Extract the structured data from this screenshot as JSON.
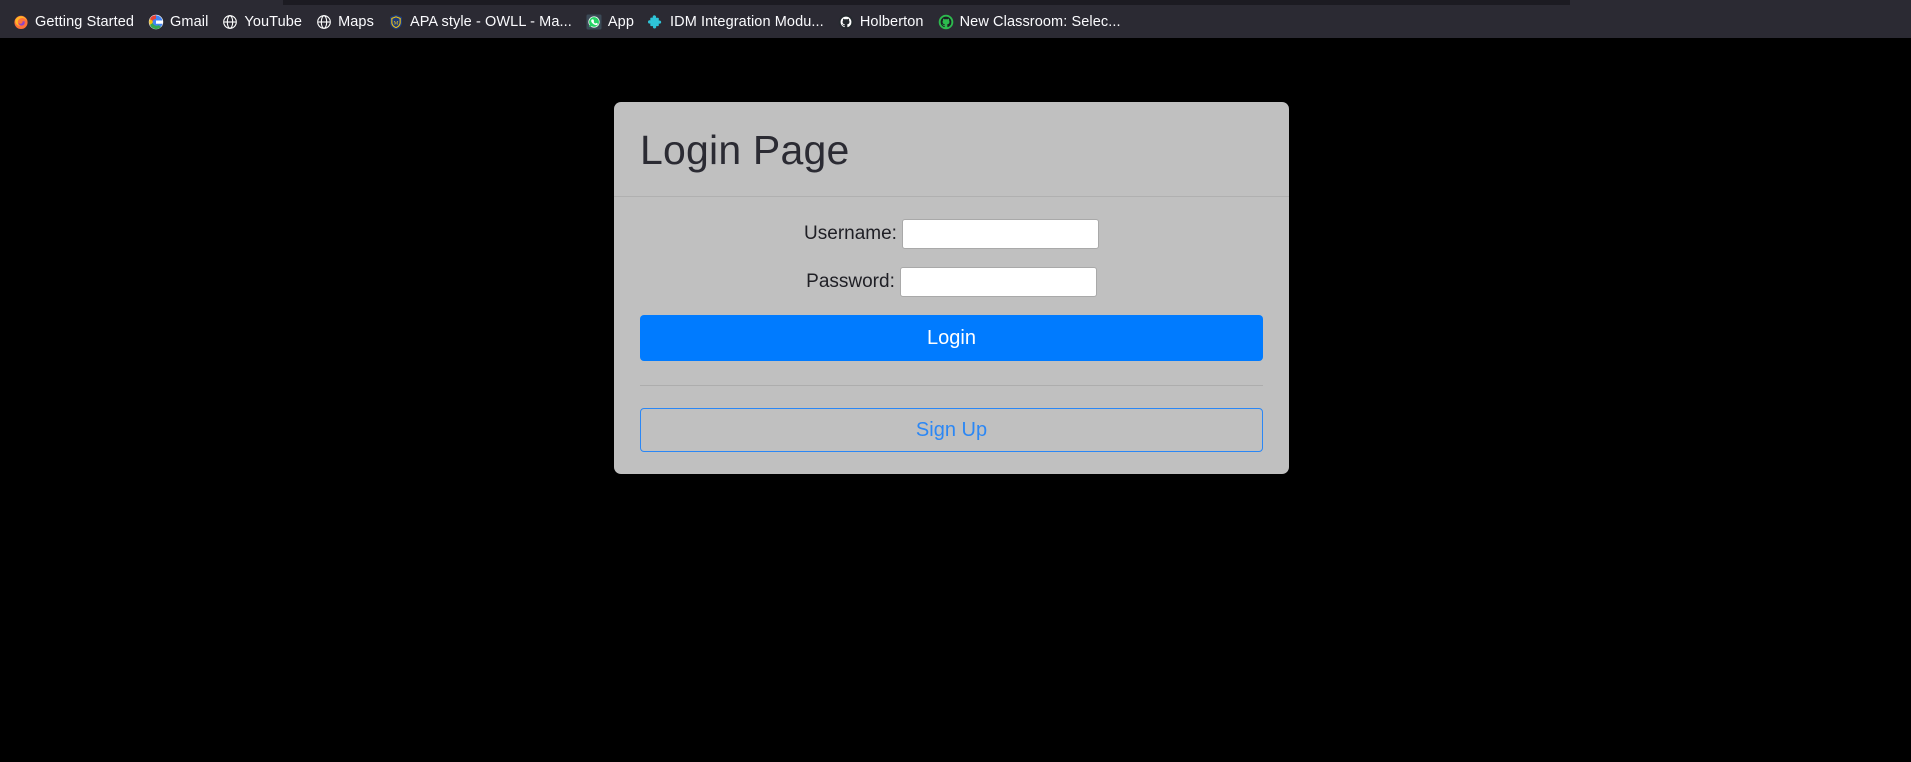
{
  "browser": {
    "bookmarks": [
      {
        "label": "Getting Started",
        "icon": "firefox-icon"
      },
      {
        "label": "Gmail",
        "icon": "gmail-icon"
      },
      {
        "label": "YouTube",
        "icon": "globe-icon"
      },
      {
        "label": "Maps",
        "icon": "globe-icon"
      },
      {
        "label": "APA style - OWLL - Ma...",
        "icon": "crest-icon"
      },
      {
        "label": "App",
        "icon": "whatsapp-icon"
      },
      {
        "label": "IDM Integration Modu...",
        "icon": "puzzle-icon"
      },
      {
        "label": "Holberton",
        "icon": "github-icon"
      },
      {
        "label": "New Classroom: Selec...",
        "icon": "github-green-icon"
      }
    ]
  },
  "login_card": {
    "title": "Login Page",
    "fields": [
      {
        "label": "Username:",
        "value": "",
        "placeholder": "",
        "type": "text",
        "name": "username"
      },
      {
        "label": "Password:",
        "value": "",
        "placeholder": "",
        "type": "password",
        "name": "password"
      }
    ],
    "login_label": "Login",
    "signup_label": "Sign Up"
  },
  "colors": {
    "chrome_bg": "#2b2a33",
    "page_bg": "#000000",
    "card_bg": "#c0c0c0",
    "primary": "#007bff",
    "link": "#2b87f5",
    "text": "#2b2b33"
  }
}
